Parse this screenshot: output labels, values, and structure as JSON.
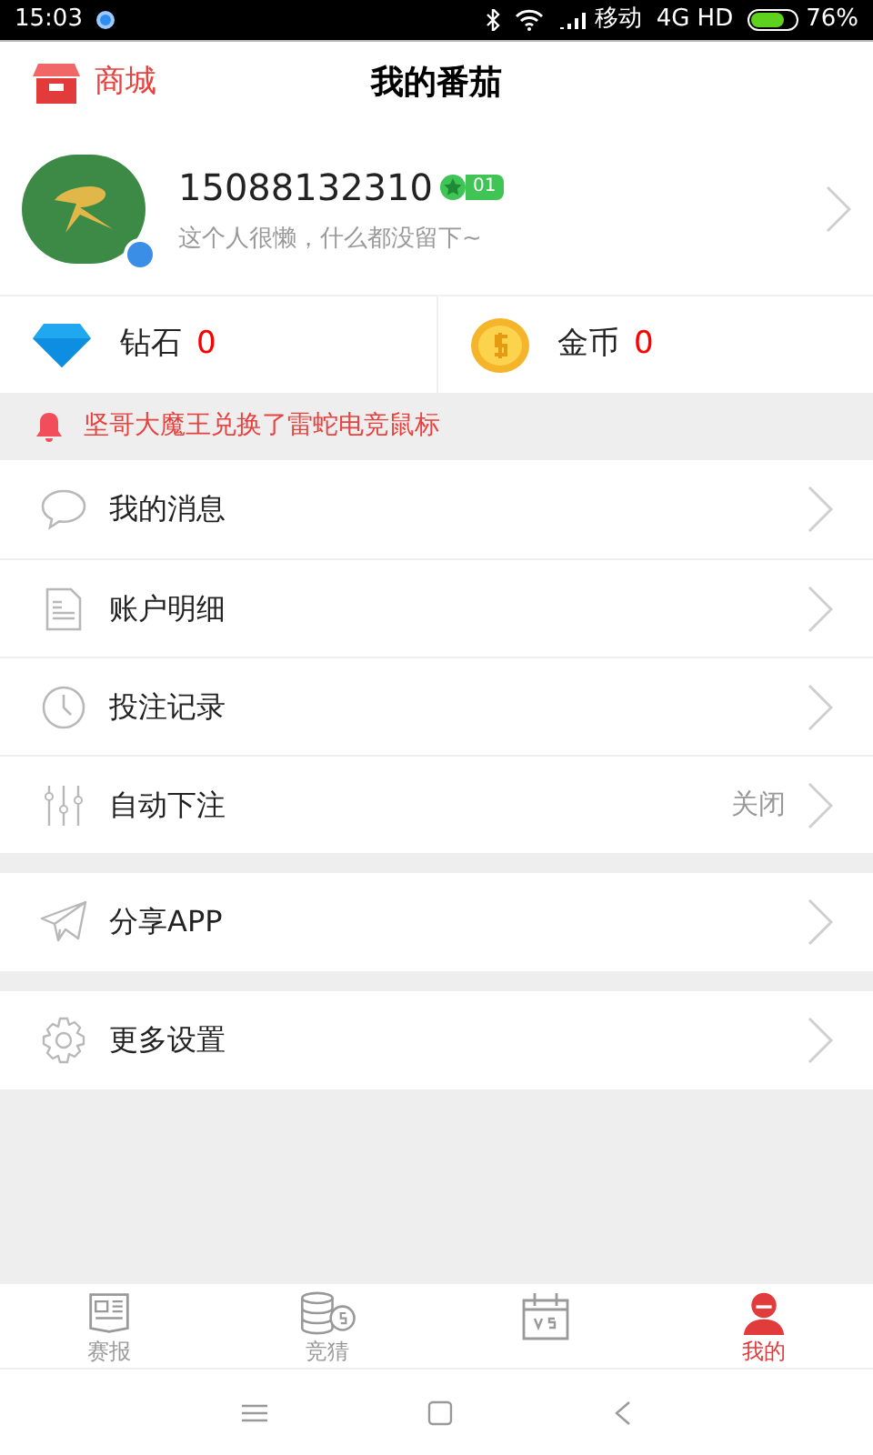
{
  "status_bar": {
    "time": "15:03",
    "carrier": "移动",
    "network": "4G HD",
    "battery": "76%"
  },
  "header": {
    "shop": "商城",
    "title": "我的番茄"
  },
  "profile": {
    "phone": "15088132310",
    "level_badge": "01",
    "bio": "这个人很懒，什么都没留下~"
  },
  "stats": [
    {
      "label": "钻石",
      "value": "0"
    },
    {
      "label": "金币",
      "value": "0"
    }
  ],
  "notice": "坚哥大魔王兑换了雷蛇电竞鼠标",
  "menu_groups": [
    [
      {
        "label": "我的消息"
      },
      {
        "label": "账户明细"
      },
      {
        "label": "投注记录"
      },
      {
        "label": "自动下注",
        "value": "关闭"
      }
    ],
    [
      {
        "label": "分享APP"
      }
    ],
    [
      {
        "label": "更多设置"
      }
    ]
  ],
  "tabs": [
    {
      "label": "赛报",
      "selected": false
    },
    {
      "label": "竞猜",
      "selected": false
    },
    {
      "selected": false
    },
    {
      "label": "我的",
      "selected": true
    }
  ]
}
